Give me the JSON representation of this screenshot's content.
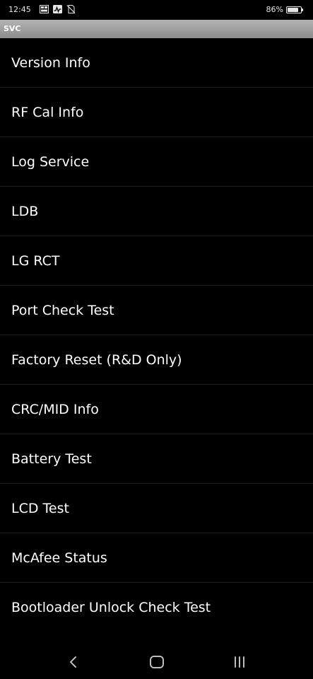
{
  "status_bar": {
    "time": "12:45",
    "icons": [
      "gallery-icon",
      "activity-icon",
      "no-sim-icon"
    ],
    "battery_percent": "86%",
    "battery_level": 0.86
  },
  "app_bar": {
    "title": "SVC"
  },
  "menu": {
    "items": [
      {
        "label": "Version Info"
      },
      {
        "label": "RF Cal Info"
      },
      {
        "label": "Log Service"
      },
      {
        "label": "LDB"
      },
      {
        "label": "LG RCT"
      },
      {
        "label": "Port Check Test"
      },
      {
        "label": "Factory Reset (R&D Only)"
      },
      {
        "label": "CRC/MID Info"
      },
      {
        "label": "Battery Test"
      },
      {
        "label": "LCD Test"
      },
      {
        "label": "McAfee Status"
      },
      {
        "label": "Bootloader Unlock Check Test"
      }
    ]
  },
  "nav_bar": {
    "buttons": [
      "back-icon",
      "home-icon",
      "recents-icon"
    ]
  },
  "colors": {
    "background": "#000000",
    "title_bar": "#a0a0a0",
    "text": "#ffffff",
    "divider": "#1f1f1f"
  }
}
